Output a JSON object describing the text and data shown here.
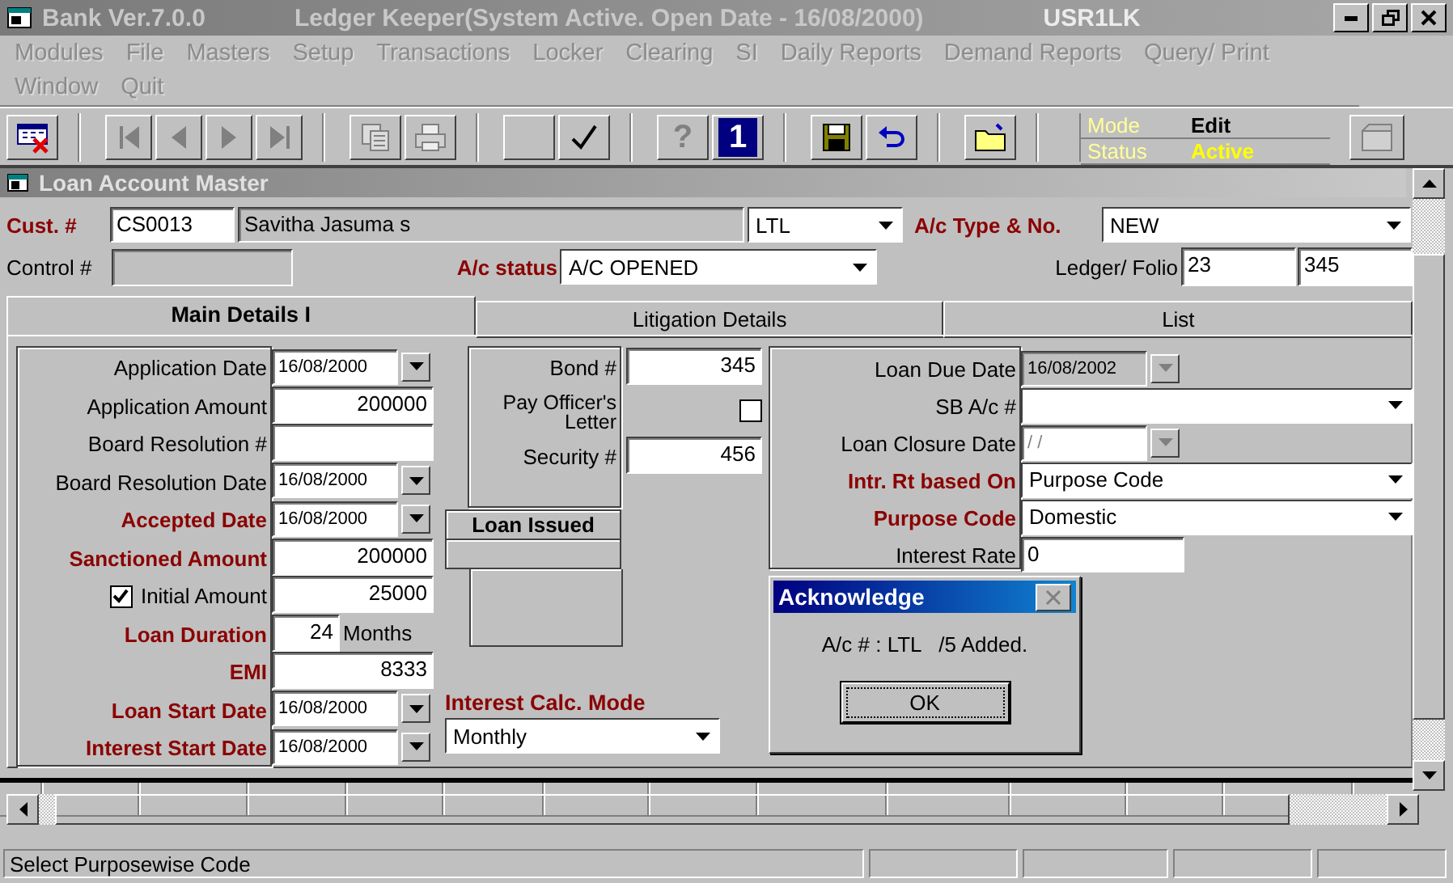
{
  "title_bar": {
    "app": "Bank Ver.7.0.0",
    "caption": "Ledger Keeper(System Active. Open Date - 16/08/2000)",
    "user": "USR1LK"
  },
  "menu": [
    {
      "label": "Modules",
      "disabled": true
    },
    {
      "label": "File",
      "disabled": true
    },
    {
      "label": "Masters",
      "disabled": true
    },
    {
      "label": "Setup",
      "disabled": true
    },
    {
      "label": "Transactions",
      "disabled": true
    },
    {
      "label": "Locker",
      "disabled": true
    },
    {
      "label": "Clearing",
      "disabled": true
    },
    {
      "label": "SI",
      "disabled": true
    },
    {
      "label": "Daily Reports",
      "disabled": true
    },
    {
      "label": "Demand Reports",
      "disabled": true
    },
    {
      "label": "Query/ Print",
      "disabled": true
    },
    {
      "label": "Window",
      "disabled": true
    },
    {
      "label": "Quit",
      "disabled": true
    }
  ],
  "toolbar": [
    [
      {
        "kind": "delete"
      }
    ],
    [
      {
        "kind": "first"
      },
      {
        "kind": "previous"
      },
      {
        "kind": "next"
      },
      {
        "kind": "last"
      }
    ],
    [
      {
        "kind": "copy"
      },
      {
        "kind": "print"
      }
    ],
    [
      {
        "kind": "blank"
      },
      {
        "kind": "check"
      }
    ],
    [
      {
        "kind": "help",
        "glyph": "?"
      },
      {
        "kind": "info",
        "glyph": "1"
      }
    ],
    [
      {
        "kind": "save"
      },
      {
        "kind": "undo"
      }
    ],
    [
      {
        "kind": "folder"
      }
    ]
  ],
  "mode_panel": {
    "mode_label": "Mode",
    "mode": "Edit",
    "status_label": "Status",
    "status": "Active"
  },
  "child_window": {
    "title": "Loan Account Master"
  },
  "customer": {
    "label": "Cust. #",
    "code": "CS0013",
    "name": "Savitha Jasuma s",
    "type": "LTL"
  },
  "ac_type": {
    "label": "A/c Type & No.",
    "value": "NEW"
  },
  "control": {
    "label": "Control #"
  },
  "ac_status": {
    "label": "A/c status",
    "value": "A/C OPENED"
  },
  "ledger_folio": {
    "label": "Ledger/ Folio",
    "ledger": "23",
    "folio": "345"
  },
  "tabs": [
    {
      "label": "Main Details I",
      "selected": true
    },
    {
      "label": "Litigation Details",
      "selected": false
    },
    {
      "label": "List",
      "selected": false
    }
  ],
  "left_fields": [
    {
      "label": "Application Date",
      "required": false,
      "kind": "date",
      "value": "16/08/2000"
    },
    {
      "label": "Application Amount",
      "required": false,
      "kind": "amount",
      "value": "200000"
    },
    {
      "label": "Board Resolution #",
      "required": false,
      "kind": "amount"
    },
    {
      "label": "Board Resolution Date",
      "required": false,
      "kind": "date",
      "value": "16/08/2000"
    },
    {
      "label": "Accepted Date",
      "required": true,
      "kind": "date",
      "value": "16/08/2000"
    },
    {
      "label": "Sanctioned Amount",
      "required": true,
      "kind": "amount",
      "value": "200000"
    },
    {
      "label": "Initial Amount",
      "required": false,
      "kind": "check",
      "checked": true,
      "value": "25000"
    },
    {
      "label": "Loan Duration",
      "required": true,
      "kind": "duration",
      "value": "24",
      "unit": "Months"
    },
    {
      "label": "EMI",
      "required": true,
      "kind": "amount",
      "value": "8333"
    },
    {
      "label": "Loan Start Date",
      "required": true,
      "kind": "date",
      "value": "16/08/2000"
    },
    {
      "label": "Interest Start Date",
      "required": true,
      "kind": "date",
      "value": "16/08/2000"
    }
  ],
  "bond": {
    "label": "Bond #",
    "value": "345"
  },
  "pay_officer": {
    "label": "Pay Officer's Letter",
    "checked": false
  },
  "security": {
    "label": "Security #",
    "value": "456"
  },
  "loan_issued": {
    "title": "Loan Issued"
  },
  "interest_calc_mode": {
    "label": "Interest Calc. Mode",
    "value": "Monthly"
  },
  "right_fields": [
    {
      "label": "Loan Due Date",
      "required": false,
      "kind": "date",
      "value": "16/08/2002",
      "disabled": true
    },
    {
      "label": "SB A/c #",
      "required": false,
      "kind": "combo"
    },
    {
      "label": "Loan Closure Date",
      "required": false,
      "kind": "date",
      "value": "/ /",
      "disabled": true
    },
    {
      "label": "Intr. Rt based On",
      "required": true,
      "kind": "combo",
      "value": "Purpose Code"
    },
    {
      "label": "Purpose Code",
      "required": true,
      "kind": "combo",
      "value": "Domestic"
    },
    {
      "label": "Interest Rate",
      "required": false,
      "kind": "text",
      "value": "0"
    }
  ],
  "dialog": {
    "title": "Acknowledge",
    "message": "A/c # : LTL   /5 Added.",
    "button": "OK"
  },
  "status_bar": {
    "text": "Select Purposewise Code"
  }
}
